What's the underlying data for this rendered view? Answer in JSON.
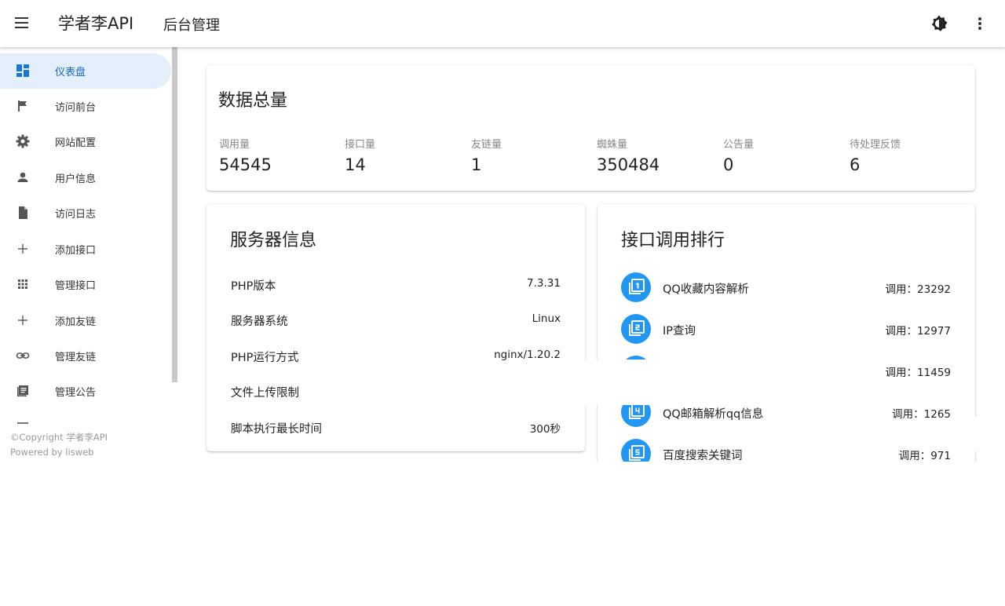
{
  "header": {
    "brand": "学者李API",
    "subtitle": "后台管理",
    "menu_icon": "hamburger-menu-icon",
    "theme_icon": "theme-toggle-icon",
    "more_icon": "more-vertical-icon"
  },
  "sidebar": {
    "items": [
      {
        "label": "仪表盘",
        "icon": "dashboard-icon",
        "active": true
      },
      {
        "label": "访问前台",
        "icon": "flag-icon"
      },
      {
        "label": "网站配置",
        "icon": "gear-icon"
      },
      {
        "label": "用户信息",
        "icon": "person-icon"
      },
      {
        "label": "访问日志",
        "icon": "file-icon"
      },
      {
        "label": "添加接口",
        "icon": "plus-icon"
      },
      {
        "label": "管理接口",
        "icon": "apps-grid-icon"
      },
      {
        "label": "添加友链",
        "icon": "plus-icon"
      },
      {
        "label": "管理友链",
        "icon": "link-icon"
      },
      {
        "label": "管理公告",
        "icon": "article-icon"
      }
    ],
    "footer_copyright": "©Copyright 学者李API",
    "footer_powered": "Powered by lisweb"
  },
  "totals": {
    "title": "数据总量",
    "stats": [
      {
        "label": "调用量",
        "value": "54545"
      },
      {
        "label": "接口量",
        "value": "14"
      },
      {
        "label": "友链量",
        "value": "1"
      },
      {
        "label": "蜘蛛量",
        "value": "350484"
      },
      {
        "label": "公告量",
        "value": "0"
      },
      {
        "label": "待处理反馈",
        "value": "6"
      }
    ]
  },
  "server": {
    "title": "服务器信息",
    "rows": [
      {
        "label": "PHP版本",
        "value": "7.3.31"
      },
      {
        "label": "服务器系统",
        "value": "Linux"
      },
      {
        "label": "PHP运行方式",
        "value": "nginx/1.20.2"
      },
      {
        "label": "文件上传限制",
        "value": ""
      },
      {
        "label": "脚本执行最长时间",
        "value": "300秒"
      }
    ]
  },
  "ranking": {
    "title": "接口调用排行",
    "rows": [
      {
        "rank": "1",
        "name": "QQ收藏内容解析",
        "count": "调用：23292"
      },
      {
        "rank": "2",
        "name": "IP查询",
        "count": "调用：12977"
      },
      {
        "rank": "3",
        "name": "",
        "count": "调用：11459"
      },
      {
        "rank": "4",
        "name": "QQ邮箱解析qq信息",
        "count": "调用：1265"
      },
      {
        "rank": "5",
        "name": "百度搜索关键词",
        "count": "调用：971"
      }
    ]
  },
  "colors": {
    "accent": "#2196f3",
    "active_bg": "#e3effb",
    "active_text": "#1565c0"
  }
}
